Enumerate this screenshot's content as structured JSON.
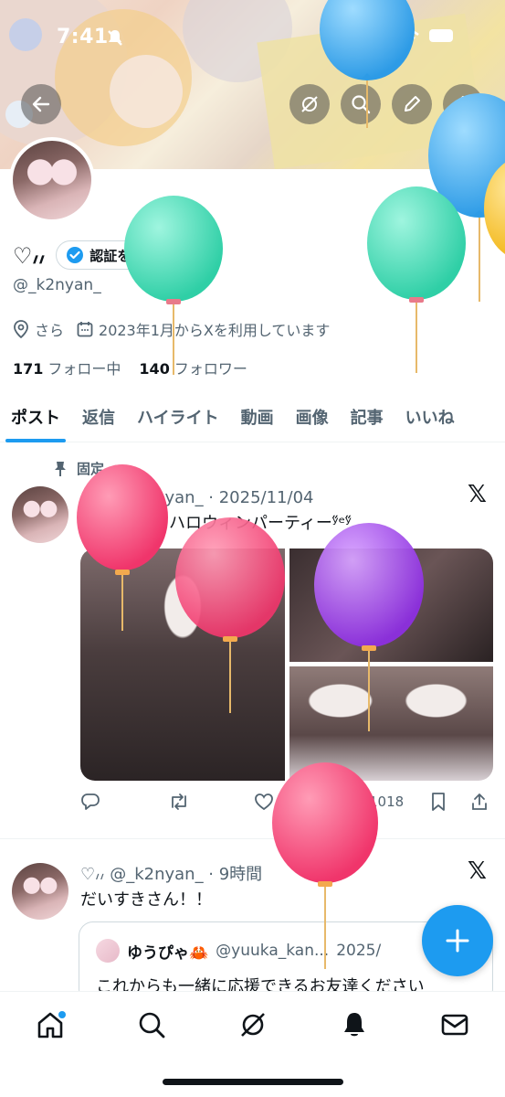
{
  "status_bar": {
    "time": "7:41"
  },
  "profile": {
    "name": "♡៸៸",
    "verify_label": "認証を受ける",
    "handle": "@_k2nyan_",
    "location": "さら",
    "joined": "2023年1月からXを利用しています",
    "following_count": "171",
    "following_label": "フォロー中",
    "followers_count": "140",
    "followers_label": "フォロワー"
  },
  "tabs": [
    {
      "label": "ポスト",
      "active": true
    },
    {
      "label": "返信"
    },
    {
      "label": "ハイライト"
    },
    {
      "label": "動画"
    },
    {
      "label": "画像"
    },
    {
      "label": "記事"
    },
    {
      "label": "いいね"
    }
  ],
  "posts": [
    {
      "pinned_label": "固定",
      "header": "♡៸៸ @_k2nyan_ · 2025/11/04",
      "text": "ʸ̋ᵉʸ̋11.2全力ハロウィンパーティーʸ̋ᵉʸ̋",
      "likes": "28",
      "views": "1018"
    },
    {
      "header": "♡៸៸ @_k2nyan_ · 9時間",
      "text": "だいすきさん！！",
      "quote": {
        "author": "ゆうぴゃ🦀",
        "handle": "@yuuka_kan...",
        "date": "2025/",
        "text": "これからも一緒に応援できるお友達ください"
      }
    }
  ],
  "colors": {
    "accent": "#1d9bf0",
    "text": "#0f1419",
    "secondary": "#536471"
  },
  "icons": {
    "back": "arrow-left-icon",
    "grok": "grok-icon",
    "search": "search-icon",
    "edit": "edit-icon",
    "share": "share-icon",
    "home": "home-icon",
    "notifications": "bell-icon",
    "messages": "mail-icon"
  }
}
